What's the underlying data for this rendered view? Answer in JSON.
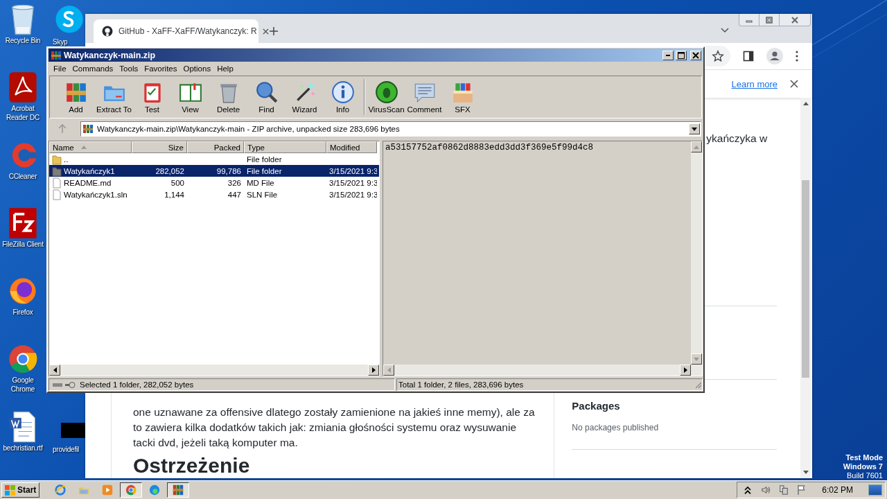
{
  "desktop": {
    "icons": [
      {
        "label": "Recycle Bin",
        "kind": "recycle"
      },
      {
        "label": "Acrobat Reader DC",
        "kind": "acrobat"
      },
      {
        "label": "CCleaner",
        "kind": "ccleaner"
      },
      {
        "label": "FileZilla Client",
        "kind": "filezilla"
      },
      {
        "label": "Firefox",
        "kind": "firefox"
      },
      {
        "label": "Google Chrome",
        "kind": "chrome"
      },
      {
        "label": "bechristian.rtf",
        "kind": "word"
      }
    ],
    "icons_second_column": [
      {
        "label": "Skyp",
        "kind": "skype"
      },
      {
        "label": "providefil",
        "kind": "blank"
      }
    ],
    "test_mode": [
      "Test Mode",
      "Windows 7",
      "Build 7601"
    ]
  },
  "browser": {
    "tab": {
      "title": "GitHub - XaFF-XaFF/Watykanczyk: R"
    },
    "infobar": {
      "link": "Learn more"
    },
    "page": {
      "about_fragment": "ykańczyka w",
      "paragraph_lines": [
        "one uznawane za offensive dlatego zostały zamienione na jakieś inne memy), ale za",
        "to zawiera kilka dodatków takich jak: zmiania głośności systemu oraz wysuwanie",
        "tacki dvd, jeżeli taką komputer ma."
      ],
      "heading": "Ostrzeżenie",
      "packages": {
        "title": "Packages",
        "text": "No packages published"
      }
    }
  },
  "archiver": {
    "title": "Watykanczyk-main.zip",
    "menu": [
      "File",
      "Commands",
      "Tools",
      "Favorites",
      "Options",
      "Help"
    ],
    "toolbar": [
      {
        "label": "Add",
        "kind": "add"
      },
      {
        "label": "Extract To",
        "kind": "extract"
      },
      {
        "label": "Test",
        "kind": "test"
      },
      {
        "label": "View",
        "kind": "view"
      },
      {
        "label": "Delete",
        "kind": "delete"
      },
      {
        "label": "Find",
        "kind": "find"
      },
      {
        "label": "Wizard",
        "kind": "wizard"
      },
      {
        "label": "Info",
        "kind": "info"
      },
      {
        "label": "VirusScan",
        "kind": "virusscan"
      },
      {
        "label": "Comment",
        "kind": "comment"
      },
      {
        "label": "SFX",
        "kind": "sfx"
      }
    ],
    "path": "Watykanczyk-main.zip\\Watykanczyk-main - ZIP archive, unpacked size 283,696 bytes",
    "columns": [
      {
        "label": "Name",
        "sorted": true
      },
      {
        "label": "Size",
        "sorted": false
      },
      {
        "label": "Packed",
        "sorted": false
      },
      {
        "label": "Type",
        "sorted": false
      },
      {
        "label": "Modified",
        "sorted": false
      }
    ],
    "rows": [
      {
        "kind": "parent",
        "name": "..",
        "type": "File folder",
        "selected": false
      },
      {
        "kind": "folder",
        "name": "Watykańczyk1",
        "size": "282,052",
        "packed": "99,786",
        "type": "File folder",
        "modified": "3/15/2021 9:3",
        "selected": true
      },
      {
        "kind": "file",
        "name": "README.md",
        "size": "500",
        "packed": "326",
        "type": "MD File",
        "modified": "3/15/2021 9:3",
        "selected": false
      },
      {
        "kind": "file",
        "name": "Watykańczyk1.sln",
        "size": "1,144",
        "packed": "447",
        "type": "SLN File",
        "modified": "3/15/2021 9:3",
        "selected": false
      }
    ],
    "comment": "a53157752af0862d8883edd3dd3f369e5f99d4c8",
    "status_left": "Selected 1 folder, 282,052 bytes",
    "status_right": "Total 1 folder, 2 files, 283,696 bytes"
  },
  "taskbar": {
    "start": "Start",
    "apps": [
      {
        "kind": "ie",
        "open": false
      },
      {
        "kind": "explorer",
        "open": false
      },
      {
        "kind": "media",
        "open": false
      },
      {
        "kind": "chrome",
        "open": true
      },
      {
        "kind": "edge",
        "open": false
      },
      {
        "kind": "winrar",
        "open": true
      }
    ],
    "clock": "6:02 PM"
  }
}
